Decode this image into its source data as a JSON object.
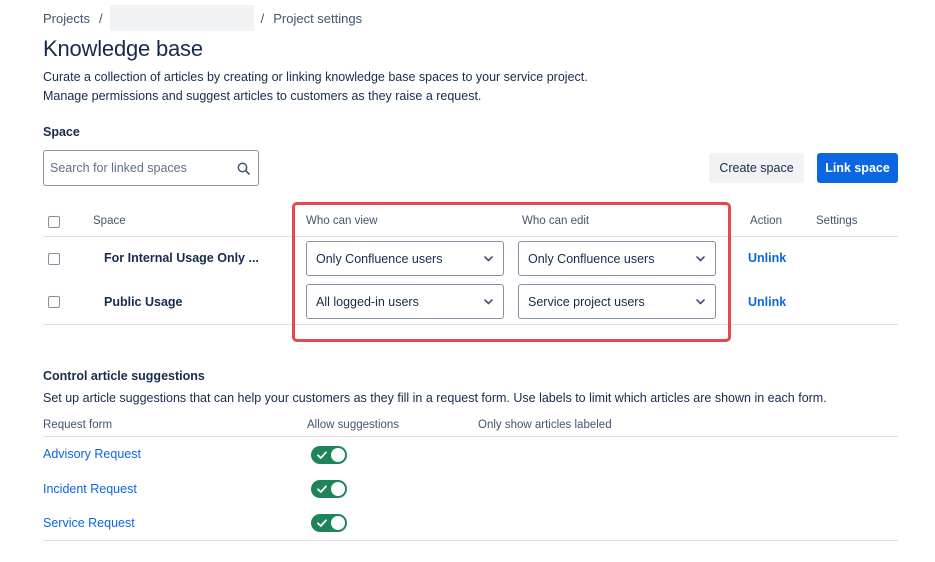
{
  "breadcrumb": {
    "projects": "Projects",
    "separator": "/",
    "current": "Project settings"
  },
  "page": {
    "title": "Knowledge base",
    "description_line1": "Curate a collection of articles by creating or linking knowledge base spaces to your service project.",
    "description_line2": "Manage permissions and suggest articles to customers as they raise a request."
  },
  "space_section": {
    "label": "Space",
    "search_placeholder": "Search for linked spaces",
    "create_button": "Create space",
    "link_button": "Link space"
  },
  "spaces_table": {
    "headers": {
      "space": "Space",
      "who_can_view": "Who can view",
      "who_can_edit": "Who can edit",
      "action": "Action",
      "settings": "Settings"
    },
    "rows": [
      {
        "name": "For Internal Usage Only ...",
        "view": "Only Confluence users",
        "edit": "Only Confluence users",
        "action": "Unlink"
      },
      {
        "name": "Public Usage",
        "view": "All logged-in users",
        "edit": "Service project users",
        "action": "Unlink"
      }
    ]
  },
  "suggestions": {
    "title": "Control article suggestions",
    "description": "Set up article suggestions that can help your customers as they fill in a request form. Use labels to limit which articles are shown in each form.",
    "headers": {
      "request_form": "Request form",
      "allow": "Allow suggestions",
      "labels": "Only show articles labeled"
    },
    "rows": [
      {
        "form": "Advisory Request",
        "enabled": true
      },
      {
        "form": "Incident Request",
        "enabled": true
      },
      {
        "form": "Service Request",
        "enabled": true
      }
    ]
  },
  "colors": {
    "primary": "#0c66e4",
    "toggle_on": "#1f845a",
    "highlight": "#e5484d"
  },
  "icons": [
    "search-icon",
    "chevron-down-icon",
    "check-icon"
  ]
}
